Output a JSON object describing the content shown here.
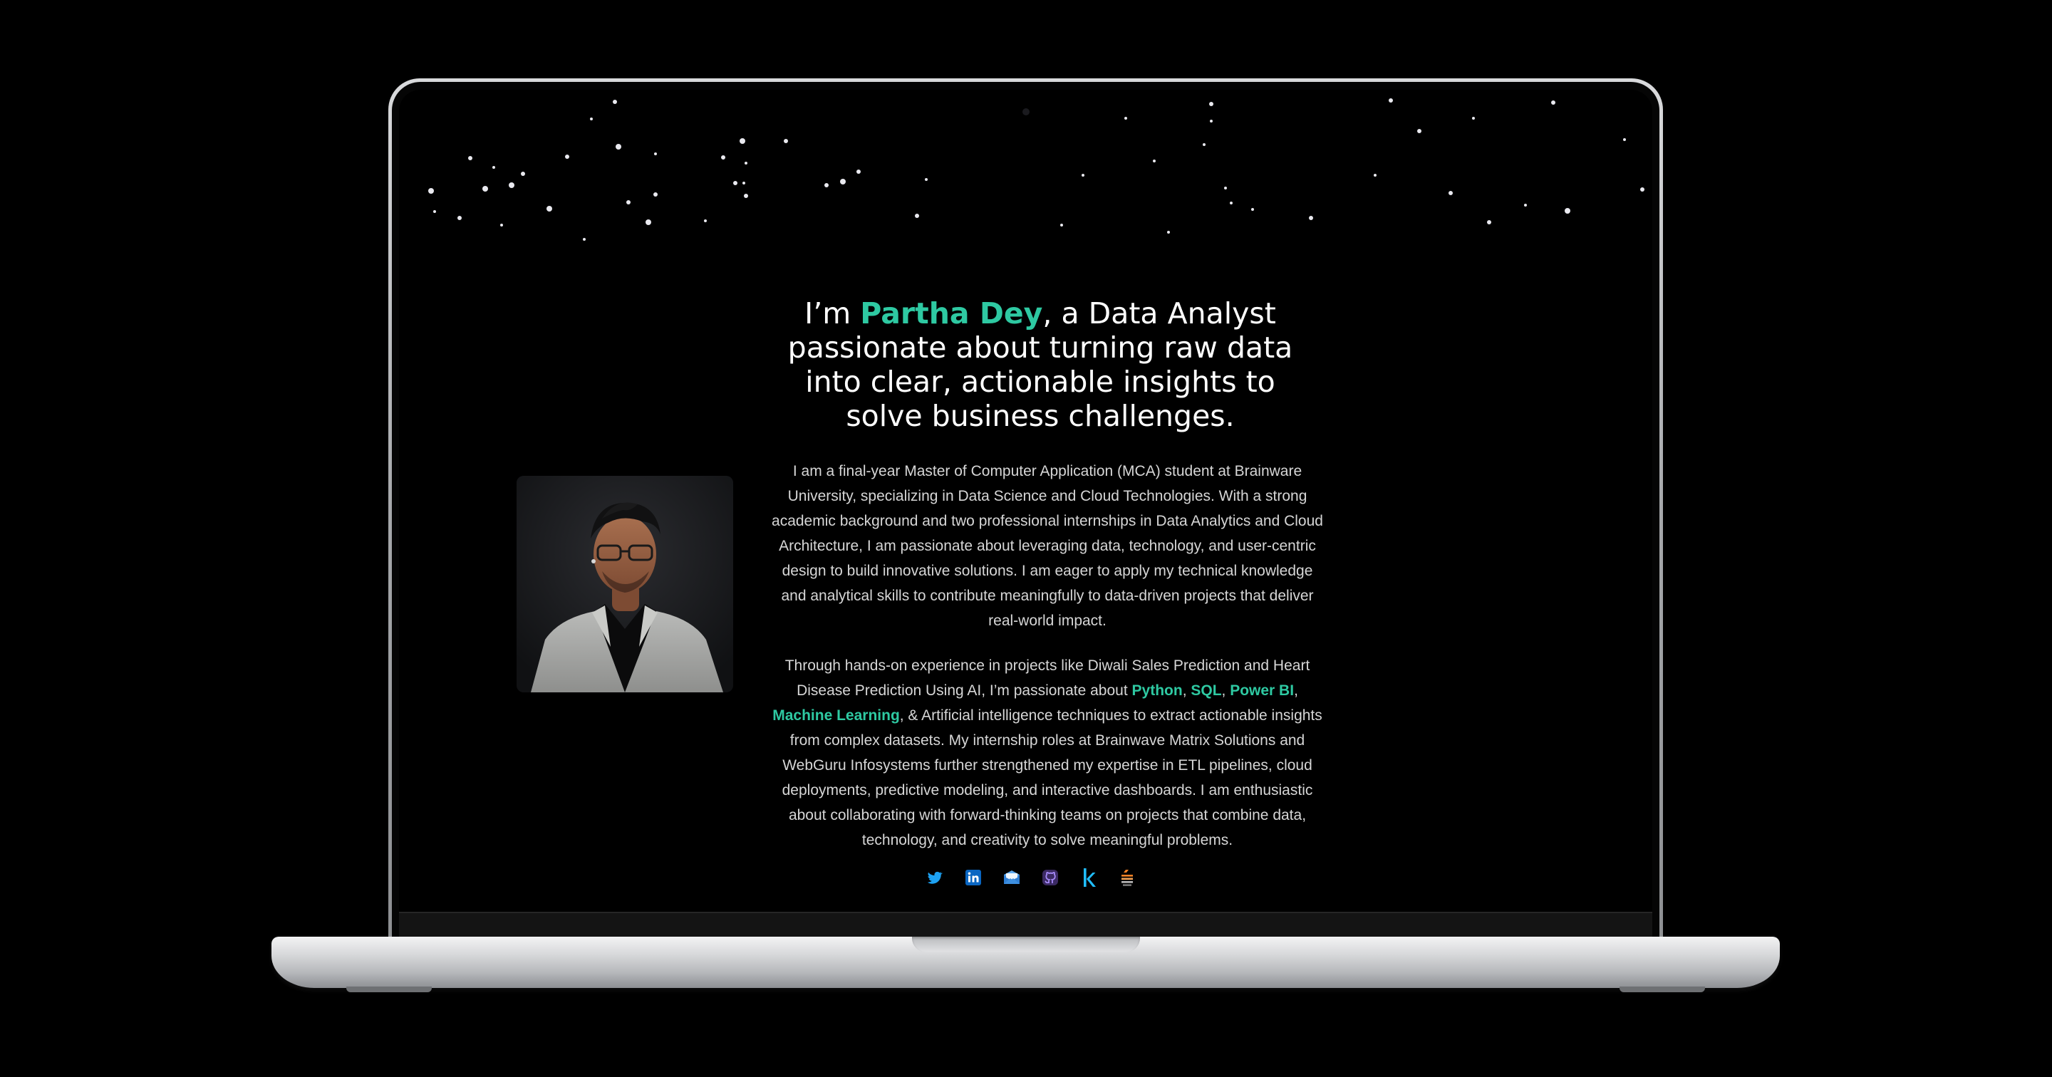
{
  "hero": {
    "title_prefix": "I’m ",
    "name": "Partha Dey",
    "title_suffix": ", a Data Analyst passionate about turning raw data into clear, actionable insights to solve business challenges."
  },
  "profile_photo": {
    "alt": "Partha Dey"
  },
  "about": {
    "paragraph1": "I am a final-year Master of Computer Application (MCA) student at Brainware University, specializing in Data Science and Cloud Technologies. With a strong academic background and two professional internships in Data Analytics and Cloud Architecture, I am passionate about leveraging data, technology, and user-centric design to build innovative solutions. I am eager to apply my technical knowledge and analytical skills to contribute meaningfully to data-driven projects that deliver real-world impact.",
    "p2_intro": "Through hands-on experience in projects like Diwali Sales Prediction and Heart Disease Prediction Using AI, I’m passionate about ",
    "skill_python": "Python",
    "sep1": ", ",
    "skill_sql": "SQL",
    "sep2": ", ",
    "skill_powerbi": "Power BI",
    "sep3": ", ",
    "skill_ml": "Machine Learning",
    "p2_rest": ", & Artificial intelligence techniques to extract actionable insights from complex datasets. My internship roles at Brainwave Matrix Solutions and WebGuru Infosystems further strengthened my expertise in ETL pipelines, cloud deployments, predictive modeling, and interactive dashboards. I am enthusiastic about collaborating with forward-thinking teams on projects that combine data, technology, and creativity to solve meaningful problems."
  },
  "socials": [
    {
      "icon": "twitter-icon",
      "color": "#1da1f2"
    },
    {
      "icon": "linkedin-icon",
      "color": "#0a66c2"
    },
    {
      "icon": "mail-icon",
      "color": "#3d8fe0"
    },
    {
      "icon": "github-icon",
      "color": "#8b5cf6"
    },
    {
      "icon": "kaggle-icon",
      "color": "#20beff"
    },
    {
      "icon": "stackoverflow-icon",
      "color": "#f48024"
    }
  ],
  "colors": {
    "accent": "#2ec9a2",
    "background": "#000000",
    "text": "#d6d6d6"
  }
}
